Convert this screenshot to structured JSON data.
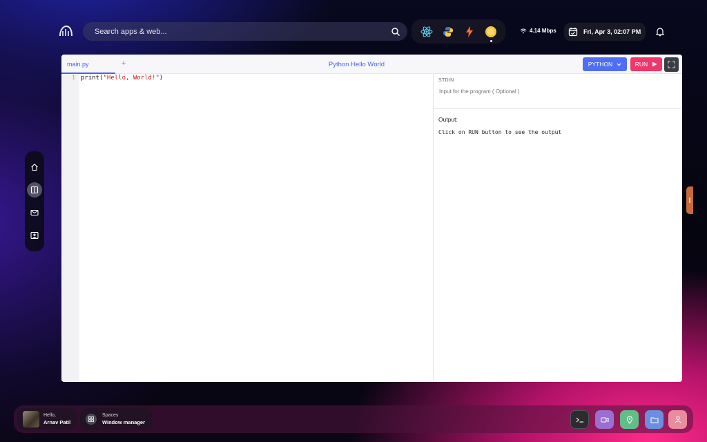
{
  "topbar": {
    "search_placeholder": "Search apps & web...",
    "apps": [
      "react-icon",
      "python-icon",
      "bolt-icon",
      "sun-icon"
    ],
    "network_speed": "4.14 Mbps",
    "datetime": "Fri, Apr 3, 02:07 PM"
  },
  "leftdock": {
    "items": [
      "home-icon",
      "split-view-icon",
      "mail-icon",
      "contacts-icon"
    ],
    "active": "split-view-icon"
  },
  "editor": {
    "tab_label": "main.py",
    "tab_add": "+",
    "title": "Python Hello World",
    "language_label": "PYTHON",
    "run_label": "RUN",
    "line_number": "1",
    "code_prefix": "print(",
    "code_string": "\"Hello, World!\"",
    "code_suffix": ")",
    "stdin_label": "STDIN",
    "stdin_placeholder": "Input for the program ( Optional )",
    "output_label": "Output:",
    "output_text": "Click on RUN button to see the output"
  },
  "bottombar": {
    "greeting": "Hello,",
    "user_name": "Arnav Patil",
    "spaces_label": "Spaces",
    "spaces_sub": "Window manager",
    "tray": [
      {
        "icon": "terminal-icon",
        "color": "#2b2b30"
      },
      {
        "icon": "video-icon",
        "color": "#9a6fd0"
      },
      {
        "icon": "map-pin-icon",
        "color": "#5fbf86"
      },
      {
        "icon": "folder-icon",
        "color": "#6a8fe0"
      },
      {
        "icon": "user-icon",
        "color": "#e88c9e"
      }
    ]
  },
  "colors": {
    "accent_blue": "#4f6ef5",
    "run_pink": "#f0376b"
  }
}
